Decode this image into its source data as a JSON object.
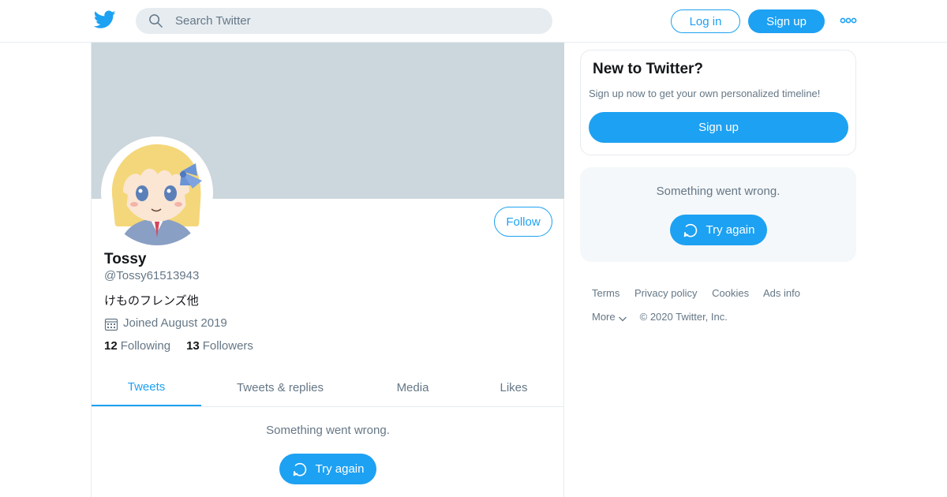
{
  "header": {
    "search_placeholder": "Search Twitter",
    "login_label": "Log in",
    "signup_label": "Sign up",
    "logo_icon": "twitter-bird-icon",
    "more_icon": "more-dots-icon",
    "brand_color": "#1da1f2"
  },
  "profile": {
    "display_name": "Tossy",
    "handle": "@Tossy61513943",
    "bio": "けものフレンズ他",
    "joined": "Joined August 2019",
    "following_count": "12",
    "following_label": "Following",
    "followers_count": "13",
    "followers_label": "Followers",
    "follow_label": "Follow",
    "banner_color": "#ccd6dd"
  },
  "tabs": [
    {
      "label": "Tweets",
      "active": true
    },
    {
      "label": "Tweets & replies",
      "active": false
    },
    {
      "label": "Media",
      "active": false
    },
    {
      "label": "Likes",
      "active": false
    }
  ],
  "timeline": {
    "error_text": "Something went wrong.",
    "retry_label": "Try again"
  },
  "sidebar": {
    "new_title": "New to Twitter?",
    "new_subtitle": "Sign up now to get your own personalized timeline!",
    "signup_label": "Sign up",
    "trends_error_text": "Something went wrong.",
    "trends_retry_label": "Try again"
  },
  "footer": {
    "links": [
      "Terms",
      "Privacy policy",
      "Cookies",
      "Ads info"
    ],
    "more_label": "More",
    "copyright": "© 2020 Twitter, Inc."
  }
}
